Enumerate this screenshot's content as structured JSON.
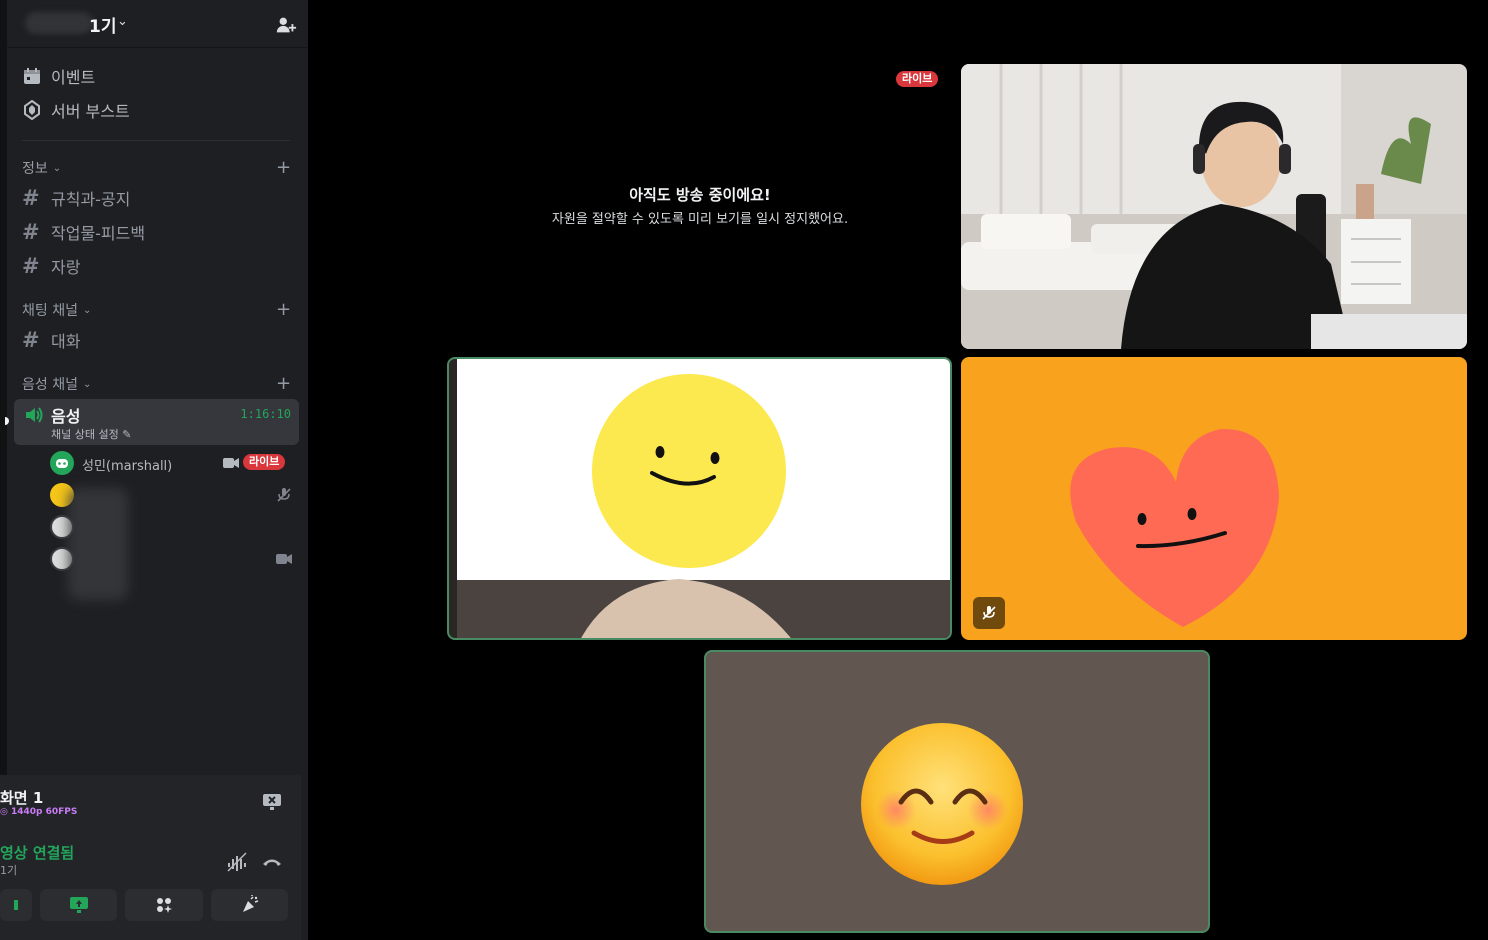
{
  "server": {
    "name": "1기"
  },
  "sidebar": {
    "top_items": [
      {
        "label": "이벤트",
        "icon": "calendar-icon"
      },
      {
        "label": "서버 부스트",
        "icon": "boost-icon"
      }
    ],
    "categories": [
      {
        "label": "정보",
        "channels": [
          "규칙과-공지",
          "작업물-피드백",
          "자랑"
        ]
      },
      {
        "label": "채팅 채널",
        "channels": [
          "대화"
        ]
      },
      {
        "label": "음성 채널"
      }
    ],
    "voice_channel": {
      "name": "음성",
      "status": "채널 상태 설정",
      "timer": "1:16:10",
      "users": [
        {
          "name": "성민(marshall)",
          "live": "라이브"
        }
      ]
    }
  },
  "stream_panel": {
    "title": "화면 1",
    "quality": "1440p 60FPS"
  },
  "voice_panel": {
    "status": "영상 연결됨",
    "sub": "1기"
  },
  "stage": {
    "paused_title": "아직도 방송 중이에요!",
    "paused_subtitle": "자원을 절약할 수 있도록 미리 보기를 일시 정지했어요.",
    "live_badge": "라이브"
  },
  "colors": {
    "accent_green": "#23a55a",
    "live_red": "#da373c",
    "sidebar_bg": "#1e1f22"
  }
}
